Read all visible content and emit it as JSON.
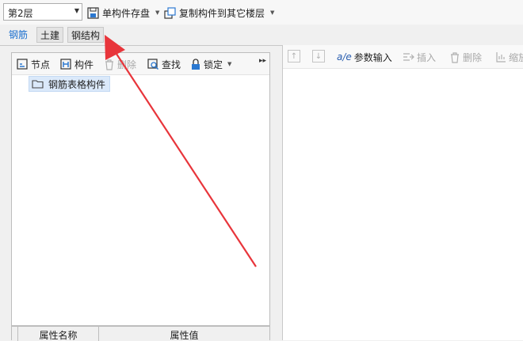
{
  "toolbar": {
    "floor_value": "第2层",
    "save_component_label": "单构件存盘",
    "copy_component_label": "复制构件到其它楼层"
  },
  "tabs": [
    {
      "label": "钢筋"
    },
    {
      "label": "土建"
    },
    {
      "label": "钢结构"
    }
  ],
  "left_toolbar": {
    "node_label": "节点",
    "component_label": "构件",
    "delete_label": "删除",
    "find_label": "查找",
    "lock_label": "锁定"
  },
  "tree": {
    "root_label": "钢筋表格构件"
  },
  "properties": {
    "col_name": "属性名称",
    "col_value": "属性值"
  },
  "right_toolbar": {
    "param_input_label": "参数输入",
    "insert_label": "插入",
    "delete_label": "删除",
    "scale_label": "缩放"
  },
  "colors": {
    "active_tab": "#1a6fcf",
    "selection_bg": "#dbe9fa",
    "annotation_arrow": "#e8353b"
  },
  "icons": [
    "chevron-down-icon",
    "save-icon",
    "copy-icon",
    "node-icon",
    "component-icon",
    "trash-icon",
    "find-icon",
    "lock-icon",
    "expand-icon",
    "folder-icon",
    "arrow-up-icon",
    "arrow-down-icon",
    "param-input-icon",
    "insert-icon",
    "scale-icon"
  ]
}
